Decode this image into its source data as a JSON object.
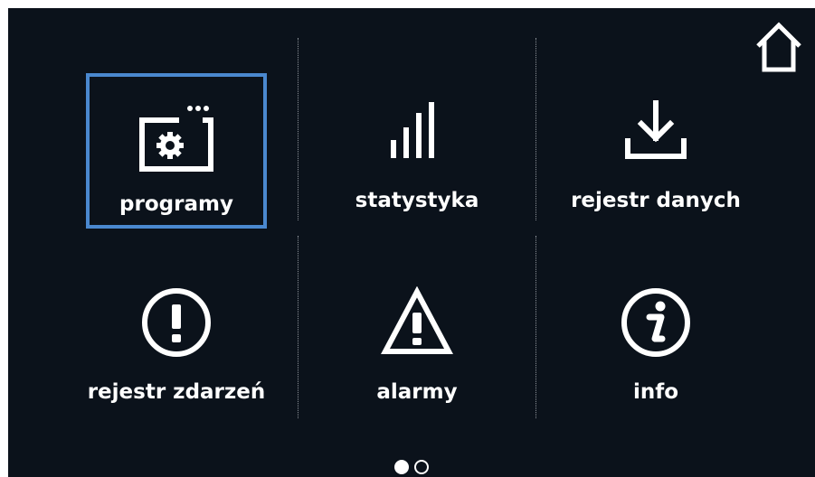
{
  "home": {
    "icon": "home-icon"
  },
  "tiles": [
    {
      "label": "programy",
      "icon": "program-settings-icon",
      "selected": true
    },
    {
      "label": "statystyka",
      "icon": "bar-chart-icon",
      "selected": false
    },
    {
      "label": "rejestr danych",
      "icon": "download-icon",
      "selected": false
    },
    {
      "label": "rejestr zdarzeń",
      "icon": "exclamation-circle-icon",
      "selected": false
    },
    {
      "label": "alarmy",
      "icon": "warning-triangle-icon",
      "selected": false
    },
    {
      "label": "info",
      "icon": "info-icon",
      "selected": false
    }
  ],
  "pagination": {
    "current_page": 1,
    "total_pages": 2
  },
  "colors": {
    "background": "#0b121b",
    "selection": "#4a88cf",
    "foreground": "#ffffff"
  }
}
